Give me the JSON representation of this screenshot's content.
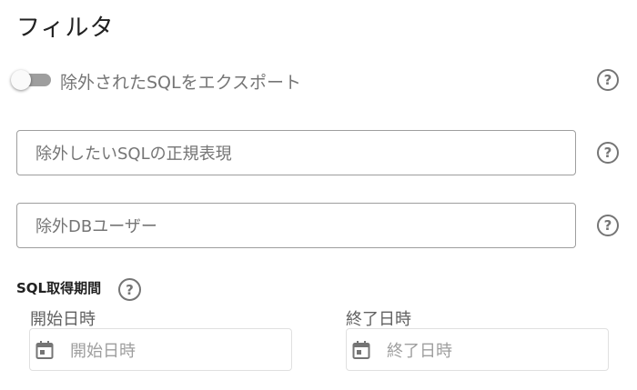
{
  "filter": {
    "title": "フィルタ",
    "export_toggle": {
      "label": "除外されたSQLをエクスポート",
      "enabled": false
    },
    "exclude_sql_regex": {
      "placeholder": "除外したいSQLの正規表現"
    },
    "exclude_db_user": {
      "placeholder": "除外DBユーザー"
    },
    "period": {
      "label": "SQL取得期間",
      "start": {
        "label": "開始日時",
        "placeholder": "開始日時"
      },
      "end": {
        "label": "終了日時",
        "placeholder": "終了日時"
      }
    }
  },
  "icons": {
    "help": "help-circle-icon",
    "calendar": "calendar-icon"
  },
  "help_glyph": "?",
  "colors": {
    "icon_gray": "#757575",
    "text_muted": "#757575",
    "border": "#9e9e9e",
    "toggle_off": "#9e9e9e"
  }
}
